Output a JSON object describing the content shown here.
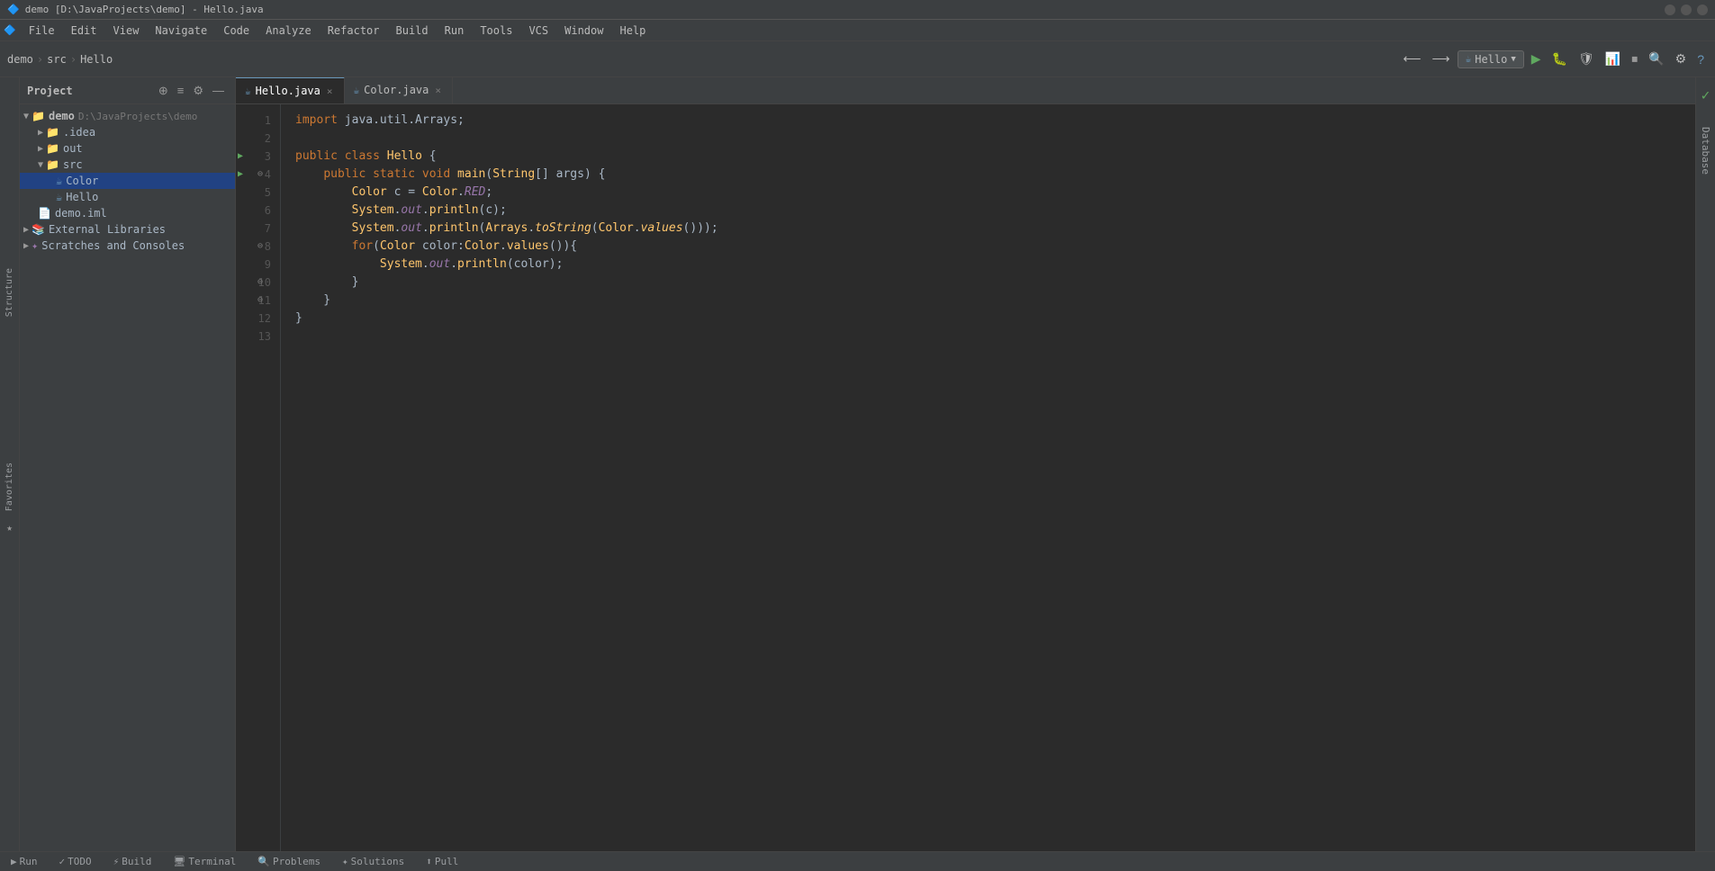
{
  "titlebar": {
    "title": "demo [D:\\JavaProjects\\demo] - Hello.java",
    "min_label": "−",
    "max_label": "□",
    "close_label": "×"
  },
  "menubar": {
    "items": [
      "File",
      "Edit",
      "View",
      "Navigate",
      "Code",
      "Analyze",
      "Refactor",
      "Build",
      "Run",
      "Tools",
      "VCS",
      "Window",
      "Help"
    ]
  },
  "breadcrumb": {
    "parts": [
      "demo",
      "src",
      "Hello"
    ]
  },
  "toolbar": {
    "run_config": "Hello",
    "actions": [
      "⟲",
      "⇋",
      "↕",
      "⚙",
      "—"
    ]
  },
  "tabs": [
    {
      "label": "Hello.java",
      "active": true,
      "icon": "☕"
    },
    {
      "label": "Color.java",
      "active": false,
      "icon": "☕"
    }
  ],
  "project_panel": {
    "title": "Project",
    "tree": [
      {
        "level": 0,
        "label": "demo",
        "path": "D:\\JavaProjects\\demo",
        "type": "project",
        "expanded": true
      },
      {
        "level": 1,
        "label": ".idea",
        "type": "folder",
        "expanded": false
      },
      {
        "level": 1,
        "label": "out",
        "type": "folder",
        "expanded": false
      },
      {
        "level": 1,
        "label": "src",
        "type": "folder",
        "expanded": true
      },
      {
        "level": 2,
        "label": "Color",
        "type": "java",
        "selected": true
      },
      {
        "level": 2,
        "label": "Hello",
        "type": "java"
      },
      {
        "level": 1,
        "label": "demo.iml",
        "type": "iml"
      },
      {
        "level": 0,
        "label": "External Libraries",
        "type": "lib",
        "expanded": false
      },
      {
        "level": 0,
        "label": "Scratches and Consoles",
        "type": "scratch",
        "expanded": false
      }
    ]
  },
  "code": {
    "lines": [
      {
        "num": 1,
        "content": "import java.util.Arrays;",
        "tokens": [
          {
            "t": "kw",
            "v": "import"
          },
          {
            "t": "type",
            "v": " java.util.Arrays;"
          }
        ]
      },
      {
        "num": 2,
        "content": "",
        "tokens": []
      },
      {
        "num": 3,
        "content": "public class Hello {",
        "tokens": [
          {
            "t": "kw",
            "v": "public"
          },
          {
            "t": "type",
            "v": " "
          },
          {
            "t": "kw",
            "v": "class"
          },
          {
            "t": "type",
            "v": " "
          },
          {
            "t": "classname",
            "v": "Hello"
          },
          {
            "t": "type",
            "v": " {"
          }
        ]
      },
      {
        "num": 4,
        "content": "    public static void main(String[] args) {",
        "tokens": [
          {
            "t": "type",
            "v": "    "
          },
          {
            "t": "kw",
            "v": "public"
          },
          {
            "t": "type",
            "v": " "
          },
          {
            "t": "kw",
            "v": "static"
          },
          {
            "t": "type",
            "v": " "
          },
          {
            "t": "kw",
            "v": "void"
          },
          {
            "t": "type",
            "v": " "
          },
          {
            "t": "method",
            "v": "main"
          },
          {
            "t": "type",
            "v": "("
          },
          {
            "t": "classname",
            "v": "String"
          },
          {
            "t": "type",
            "v": "[] args) {"
          }
        ]
      },
      {
        "num": 5,
        "content": "        Color c = Color.RED;",
        "tokens": [
          {
            "t": "type",
            "v": "        "
          },
          {
            "t": "classname",
            "v": "Color"
          },
          {
            "t": "type",
            "v": " c = "
          },
          {
            "t": "classname",
            "v": "Color"
          },
          {
            "t": "type",
            "v": "."
          },
          {
            "t": "static-field",
            "v": "RED"
          },
          {
            "t": "type",
            "v": ";"
          }
        ]
      },
      {
        "num": 6,
        "content": "        System.out.println(c);",
        "tokens": [
          {
            "t": "type",
            "v": "        "
          },
          {
            "t": "classname",
            "v": "System"
          },
          {
            "t": "type",
            "v": "."
          },
          {
            "t": "static-field",
            "v": "out"
          },
          {
            "t": "type",
            "v": "."
          },
          {
            "t": "method",
            "v": "println"
          },
          {
            "t": "type",
            "v": "(c);"
          }
        ]
      },
      {
        "num": 7,
        "content": "        System.out.println(Arrays.toString(Color.values()));",
        "tokens": [
          {
            "t": "type",
            "v": "        "
          },
          {
            "t": "classname",
            "v": "System"
          },
          {
            "t": "type",
            "v": "."
          },
          {
            "t": "static-field",
            "v": "out"
          },
          {
            "t": "type",
            "v": "."
          },
          {
            "t": "method",
            "v": "println"
          },
          {
            "t": "type",
            "v": "("
          },
          {
            "t": "classname",
            "v": "Arrays"
          },
          {
            "t": "type",
            "v": "."
          },
          {
            "t": "method",
            "v": "toString"
          },
          {
            "t": "type",
            "v": "("
          },
          {
            "t": "classname",
            "v": "Color"
          },
          {
            "t": "type",
            "v": "."
          },
          {
            "t": "method",
            "v": "values"
          },
          {
            "t": "type",
            "v": "()));"
          }
        ]
      },
      {
        "num": 8,
        "content": "        for(Color color:Color.values()){",
        "tokens": [
          {
            "t": "type",
            "v": "        "
          },
          {
            "t": "kw",
            "v": "for"
          },
          {
            "t": "type",
            "v": "("
          },
          {
            "t": "classname",
            "v": "Color"
          },
          {
            "t": "type",
            "v": " color:"
          },
          {
            "t": "classname",
            "v": "Color"
          },
          {
            "t": "type",
            "v": "."
          },
          {
            "t": "method",
            "v": "values"
          },
          {
            "t": "type",
            "v": "()){"
          }
        ]
      },
      {
        "num": 9,
        "content": "            System.out.println(color);",
        "tokens": [
          {
            "t": "type",
            "v": "            "
          },
          {
            "t": "classname",
            "v": "System"
          },
          {
            "t": "type",
            "v": "."
          },
          {
            "t": "static-field",
            "v": "out"
          },
          {
            "t": "type",
            "v": "."
          },
          {
            "t": "method",
            "v": "println"
          },
          {
            "t": "type",
            "v": "(color);"
          }
        ]
      },
      {
        "num": 10,
        "content": "        }",
        "tokens": [
          {
            "t": "type",
            "v": "        }"
          }
        ]
      },
      {
        "num": 11,
        "content": "    }",
        "tokens": [
          {
            "t": "type",
            "v": "    }"
          }
        ]
      },
      {
        "num": 12,
        "content": "}",
        "tokens": [
          {
            "t": "type",
            "v": "}"
          }
        ]
      },
      {
        "num": 13,
        "content": "",
        "tokens": []
      }
    ],
    "run_lines": [
      3,
      4
    ],
    "fold_lines": [
      8,
      10,
      11
    ]
  },
  "bottom_bar": {
    "items": [
      "▶ Run",
      "✓ TODO",
      "⚡ Build",
      "🖥 Terminal",
      "🔍 Problems",
      "✦ Solutions",
      "⬆ Pull"
    ]
  },
  "right_panel": {
    "check_icon": "✓",
    "database_label": "Database"
  },
  "left_tabs": {
    "structure_label": "Structure",
    "favorites_label": "Favorites"
  }
}
